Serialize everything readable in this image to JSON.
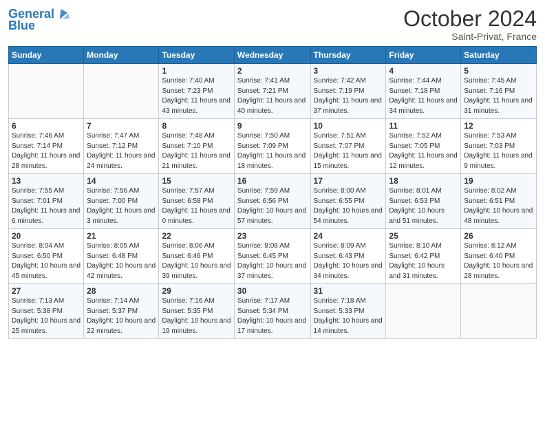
{
  "header": {
    "logo_line1": "General",
    "logo_line2": "Blue",
    "month": "October 2024",
    "location": "Saint-Privat, France"
  },
  "days_of_week": [
    "Sunday",
    "Monday",
    "Tuesday",
    "Wednesday",
    "Thursday",
    "Friday",
    "Saturday"
  ],
  "weeks": [
    [
      {
        "day": "",
        "sunrise": "",
        "sunset": "",
        "daylight": ""
      },
      {
        "day": "",
        "sunrise": "",
        "sunset": "",
        "daylight": ""
      },
      {
        "day": "1",
        "sunrise": "Sunrise: 7:40 AM",
        "sunset": "Sunset: 7:23 PM",
        "daylight": "Daylight: 11 hours and 43 minutes."
      },
      {
        "day": "2",
        "sunrise": "Sunrise: 7:41 AM",
        "sunset": "Sunset: 7:21 PM",
        "daylight": "Daylight: 11 hours and 40 minutes."
      },
      {
        "day": "3",
        "sunrise": "Sunrise: 7:42 AM",
        "sunset": "Sunset: 7:19 PM",
        "daylight": "Daylight: 11 hours and 37 minutes."
      },
      {
        "day": "4",
        "sunrise": "Sunrise: 7:44 AM",
        "sunset": "Sunset: 7:18 PM",
        "daylight": "Daylight: 11 hours and 34 minutes."
      },
      {
        "day": "5",
        "sunrise": "Sunrise: 7:45 AM",
        "sunset": "Sunset: 7:16 PM",
        "daylight": "Daylight: 11 hours and 31 minutes."
      }
    ],
    [
      {
        "day": "6",
        "sunrise": "Sunrise: 7:46 AM",
        "sunset": "Sunset: 7:14 PM",
        "daylight": "Daylight: 11 hours and 28 minutes."
      },
      {
        "day": "7",
        "sunrise": "Sunrise: 7:47 AM",
        "sunset": "Sunset: 7:12 PM",
        "daylight": "Daylight: 11 hours and 24 minutes."
      },
      {
        "day": "8",
        "sunrise": "Sunrise: 7:48 AM",
        "sunset": "Sunset: 7:10 PM",
        "daylight": "Daylight: 11 hours and 21 minutes."
      },
      {
        "day": "9",
        "sunrise": "Sunrise: 7:50 AM",
        "sunset": "Sunset: 7:09 PM",
        "daylight": "Daylight: 11 hours and 18 minutes."
      },
      {
        "day": "10",
        "sunrise": "Sunrise: 7:51 AM",
        "sunset": "Sunset: 7:07 PM",
        "daylight": "Daylight: 11 hours and 15 minutes."
      },
      {
        "day": "11",
        "sunrise": "Sunrise: 7:52 AM",
        "sunset": "Sunset: 7:05 PM",
        "daylight": "Daylight: 11 hours and 12 minutes."
      },
      {
        "day": "12",
        "sunrise": "Sunrise: 7:53 AM",
        "sunset": "Sunset: 7:03 PM",
        "daylight": "Daylight: 11 hours and 9 minutes."
      }
    ],
    [
      {
        "day": "13",
        "sunrise": "Sunrise: 7:55 AM",
        "sunset": "Sunset: 7:01 PM",
        "daylight": "Daylight: 11 hours and 6 minutes."
      },
      {
        "day": "14",
        "sunrise": "Sunrise: 7:56 AM",
        "sunset": "Sunset: 7:00 PM",
        "daylight": "Daylight: 11 hours and 3 minutes."
      },
      {
        "day": "15",
        "sunrise": "Sunrise: 7:57 AM",
        "sunset": "Sunset: 6:58 PM",
        "daylight": "Daylight: 11 hours and 0 minutes."
      },
      {
        "day": "16",
        "sunrise": "Sunrise: 7:59 AM",
        "sunset": "Sunset: 6:56 PM",
        "daylight": "Daylight: 10 hours and 57 minutes."
      },
      {
        "day": "17",
        "sunrise": "Sunrise: 8:00 AM",
        "sunset": "Sunset: 6:55 PM",
        "daylight": "Daylight: 10 hours and 54 minutes."
      },
      {
        "day": "18",
        "sunrise": "Sunrise: 8:01 AM",
        "sunset": "Sunset: 6:53 PM",
        "daylight": "Daylight: 10 hours and 51 minutes."
      },
      {
        "day": "19",
        "sunrise": "Sunrise: 8:02 AM",
        "sunset": "Sunset: 6:51 PM",
        "daylight": "Daylight: 10 hours and 48 minutes."
      }
    ],
    [
      {
        "day": "20",
        "sunrise": "Sunrise: 8:04 AM",
        "sunset": "Sunset: 6:50 PM",
        "daylight": "Daylight: 10 hours and 45 minutes."
      },
      {
        "day": "21",
        "sunrise": "Sunrise: 8:05 AM",
        "sunset": "Sunset: 6:48 PM",
        "daylight": "Daylight: 10 hours and 42 minutes."
      },
      {
        "day": "22",
        "sunrise": "Sunrise: 8:06 AM",
        "sunset": "Sunset: 6:46 PM",
        "daylight": "Daylight: 10 hours and 39 minutes."
      },
      {
        "day": "23",
        "sunrise": "Sunrise: 8:08 AM",
        "sunset": "Sunset: 6:45 PM",
        "daylight": "Daylight: 10 hours and 37 minutes."
      },
      {
        "day": "24",
        "sunrise": "Sunrise: 8:09 AM",
        "sunset": "Sunset: 6:43 PM",
        "daylight": "Daylight: 10 hours and 34 minutes."
      },
      {
        "day": "25",
        "sunrise": "Sunrise: 8:10 AM",
        "sunset": "Sunset: 6:42 PM",
        "daylight": "Daylight: 10 hours and 31 minutes."
      },
      {
        "day": "26",
        "sunrise": "Sunrise: 8:12 AM",
        "sunset": "Sunset: 6:40 PM",
        "daylight": "Daylight: 10 hours and 28 minutes."
      }
    ],
    [
      {
        "day": "27",
        "sunrise": "Sunrise: 7:13 AM",
        "sunset": "Sunset: 5:38 PM",
        "daylight": "Daylight: 10 hours and 25 minutes."
      },
      {
        "day": "28",
        "sunrise": "Sunrise: 7:14 AM",
        "sunset": "Sunset: 5:37 PM",
        "daylight": "Daylight: 10 hours and 22 minutes."
      },
      {
        "day": "29",
        "sunrise": "Sunrise: 7:16 AM",
        "sunset": "Sunset: 5:35 PM",
        "daylight": "Daylight: 10 hours and 19 minutes."
      },
      {
        "day": "30",
        "sunrise": "Sunrise: 7:17 AM",
        "sunset": "Sunset: 5:34 PM",
        "daylight": "Daylight: 10 hours and 17 minutes."
      },
      {
        "day": "31",
        "sunrise": "Sunrise: 7:18 AM",
        "sunset": "Sunset: 5:33 PM",
        "daylight": "Daylight: 10 hours and 14 minutes."
      },
      {
        "day": "",
        "sunrise": "",
        "sunset": "",
        "daylight": ""
      },
      {
        "day": "",
        "sunrise": "",
        "sunset": "",
        "daylight": ""
      }
    ]
  ]
}
